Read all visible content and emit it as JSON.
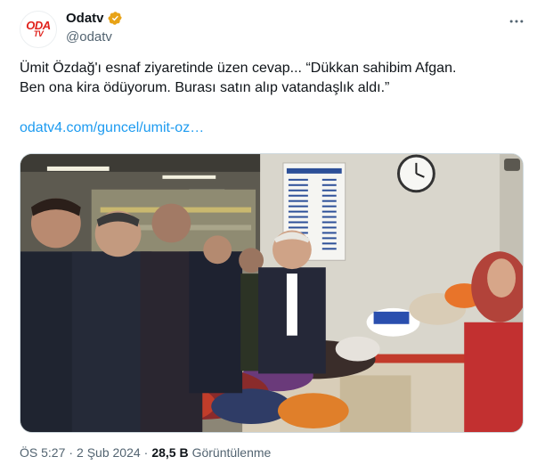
{
  "account": {
    "display_name": "Odatv",
    "handle": "@odatv",
    "logo_text": "ODA",
    "logo_subtext": "TV",
    "verified_color": "#e8a317"
  },
  "tweet": {
    "text": "Ümit Özdağ'ı esnaf ziyaretinde üzen cevap... “Dükkan sahibim Afgan.\nBen ona kira ödüyorum. Burası satın alıp vatandaşlık aldı.”",
    "link": "odatv4.com/guncel/umit-oz…",
    "media_sign": "FİYAT LİSTESİ"
  },
  "meta": {
    "time": "ÖS 5:27",
    "separator": "·",
    "date": "2 Şub 2024",
    "views_count": "28,5 B",
    "views_label": "Görüntülenme"
  },
  "colors": {
    "link": "#1d9bf0",
    "text": "#0f1419",
    "secondary": "#536471",
    "brand": "#e0211b"
  }
}
